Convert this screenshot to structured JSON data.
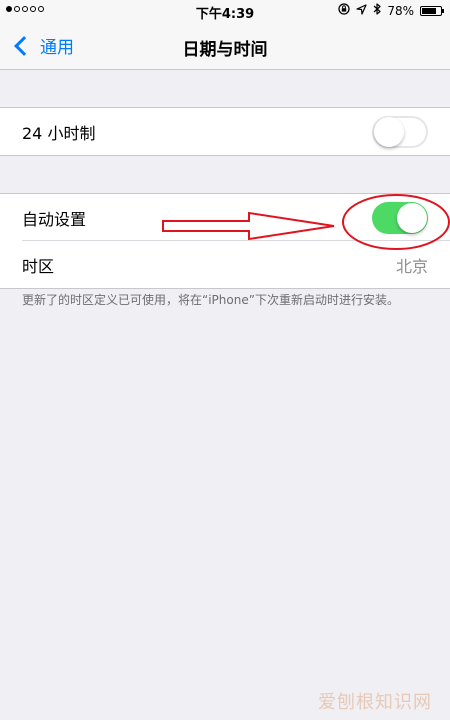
{
  "status_bar": {
    "carrier_dots": 5,
    "carrier_dots_filled": 1,
    "time": "下午4:39",
    "battery_percent": "78%",
    "battery_level": 0.78,
    "icons": [
      "lock-rotation-icon",
      "location-icon",
      "bluetooth-icon",
      "battery-icon"
    ]
  },
  "nav": {
    "back_label": "通用",
    "title": "日期与时间"
  },
  "settings": {
    "twenty_four_hour": {
      "label": "24 小时制",
      "enabled": false
    },
    "auto_set": {
      "label": "自动设置",
      "enabled": true
    },
    "time_zone": {
      "label": "时区",
      "value": "北京"
    }
  },
  "footnote": "更新了的时区定义已可使用，将在“iPhone”下次重新启动时进行安装。",
  "watermark": "爱刨根知识网",
  "colors": {
    "accent": "#007aff",
    "toggle_on": "#4cd964",
    "annotation": "#e0141e",
    "background": "#efeff4"
  }
}
